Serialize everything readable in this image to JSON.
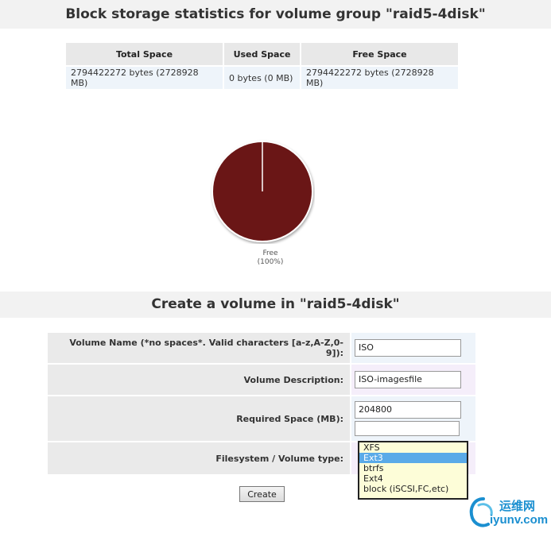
{
  "stats": {
    "title": "Block storage statistics for volume group \"raid5-4disk\"",
    "headers": [
      "Total Space",
      "Used Space",
      "Free Space"
    ],
    "values": [
      "2794422272 bytes (2728928 MB)",
      "0 bytes (0 MB)",
      "2794422272 bytes (2728928 MB)"
    ]
  },
  "pie": {
    "label": "Free",
    "percent": "(100%)",
    "free_fraction": 1.0,
    "color": "#6b1818"
  },
  "create": {
    "title": "Create a volume in \"raid5-4disk\"",
    "name_label": "Volume Name (*no spaces*. Valid characters [a-z,A-Z,0-9]):",
    "name_value": "ISO",
    "desc_label": "Volume Description:",
    "desc_value": "ISO-imagesfile",
    "space_label": "Required Space (MB):",
    "space_value": "204800",
    "space_extra": "",
    "fs_label": "Filesystem / Volume type:",
    "fs_options": [
      "XFS",
      "Ext3",
      "btrfs",
      "Ext4",
      "block (iSCSI,FC,etc)"
    ],
    "fs_selected": "Ext3",
    "button": "Create"
  },
  "watermark": {
    "cn": "运维网",
    "url": "iyunv.com"
  }
}
